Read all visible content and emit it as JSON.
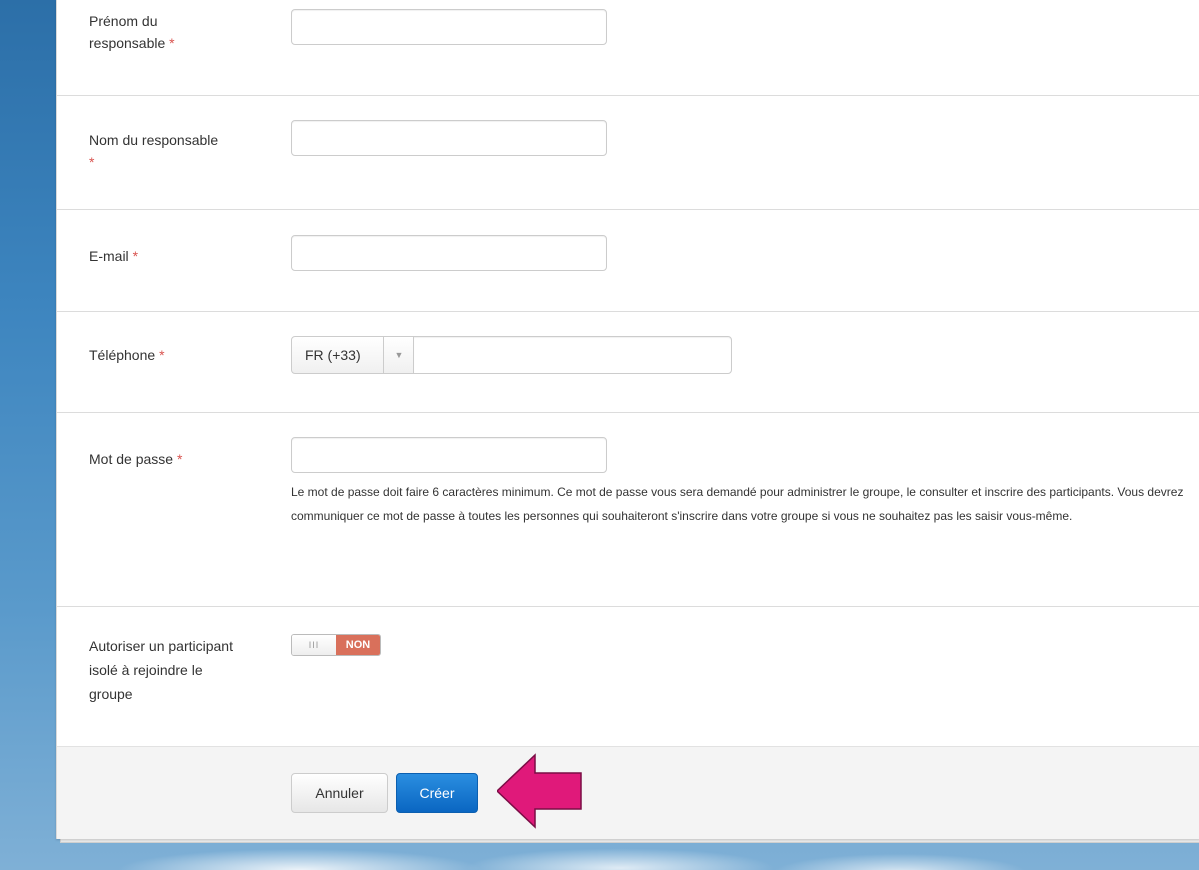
{
  "form": {
    "required_mark": "*",
    "first_name": {
      "label": "Prénom du responsable",
      "value": ""
    },
    "last_name": {
      "label": "Nom du responsable",
      "value": ""
    },
    "email": {
      "label": "E-mail",
      "value": ""
    },
    "phone": {
      "label": "Téléphone",
      "country_code": "FR (+33)",
      "value": ""
    },
    "password": {
      "label": "Mot de passe",
      "value": "",
      "help": "Le mot de passe doit faire 6 caractères minimum. Ce mot de passe vous sera demandé pour administrer le groupe, le consulter et inscrire des participants. Vous devrez communiquer ce mot de passe à toutes les personnes qui souhaiteront s'inscrire dans votre groupe si vous ne souhaitez pas les saisir vous-même."
    },
    "allow_isolated": {
      "label": "Autoriser un participant isolé à rejoindre le groupe",
      "knob_glyph": "III",
      "state_label": "NON"
    }
  },
  "actions": {
    "cancel_label": "Annuler",
    "create_label": "Créer"
  },
  "colors": {
    "primary_button": "#0a66c2",
    "toggle_off": "#d9705b",
    "required": "#d9534f",
    "annotation_arrow": "#e0197a"
  }
}
